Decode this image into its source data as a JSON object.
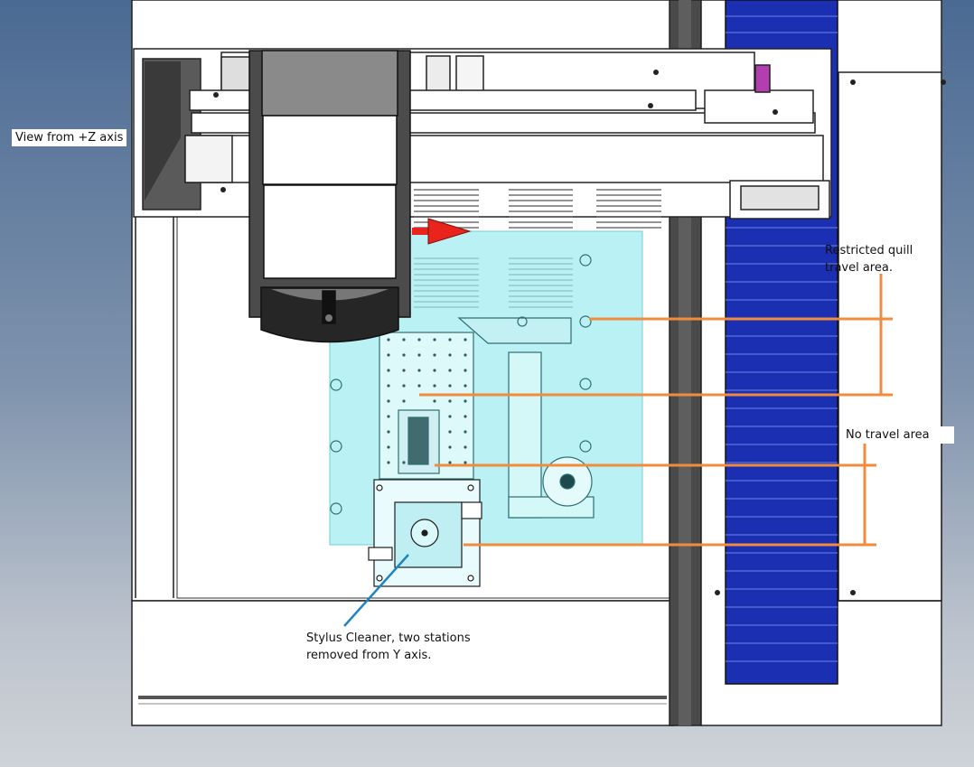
{
  "annotations": {
    "view_label": "View from +Z axis",
    "restricted_area": "Restricted quill\ntravel area.",
    "no_travel_area": "No travel area",
    "stylus_cleaner": "Stylus Cleaner, two stations\nremoved from Y axis."
  },
  "colors": {
    "background_top": "#4a6a93",
    "background_bottom": "#cfd3d8",
    "machine_frame": "#ffffff",
    "restricted_zone": "#9fecf0",
    "leader_lines": "#f28c3c",
    "stylus_leader": "#1f84bf",
    "y_axis_cover": "#1a2fb2",
    "quill_housing": "#2a2a2a",
    "axis_arrow": "#e8241d"
  }
}
